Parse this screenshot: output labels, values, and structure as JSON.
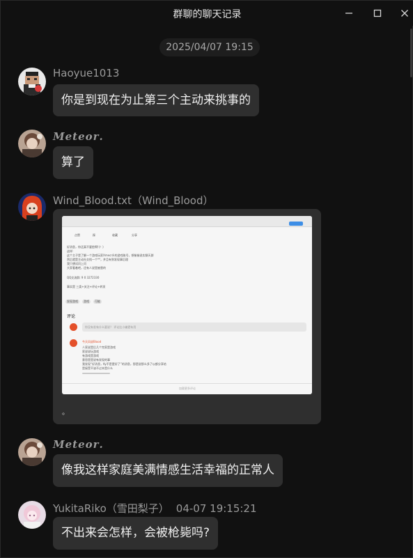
{
  "window": {
    "title": "群聊的聊天记录"
  },
  "timestamp": "2025/04/07 19:15",
  "messages": [
    {
      "sender": "Haoyue1013",
      "text": "你是到现在为止第三个主动来挑事的",
      "avatar_icon": "pixel-avatar-icon"
    },
    {
      "sender": "𝑴𝒆𝒕𝒆𝒐𝒓.",
      "text": "算了",
      "avatar_icon": "anime-avatar-icon"
    },
    {
      "sender": "Wind_Blood.txt（Wind_Blood）",
      "image_caption": "。",
      "avatar_icon": "red-hair-avatar-icon"
    },
    {
      "sender": "𝑴𝒆𝒕𝒆𝒐𝒓.",
      "text": "像我这样家庭美满情感生活幸福的正常人",
      "avatar_icon": "anime-avatar-icon"
    },
    {
      "sender": "YukitaRiko（雪田梨子）",
      "time": "04-07 19:15:21",
      "text": "不出来会怎样，会被枪毙吗?",
      "avatar_icon": "pink-hair-avatar-icon"
    }
  ],
  "screenshot": {
    "toolbar": [
      "点赞",
      "踩",
      "收藏",
      "分享"
    ],
    "body_lines": [
      "好消息，你还真不要脸啊!(！)",
      "这样:",
      "这个主子是了解一个游戏玩家Xmecr/k的游戏账号，想偷偷说实聊天群",
      "然后就是主动社交找一个**，并且有到发现事后理",
      "我只想试问上问",
      "大家看着吧，还有人说是被害的",
      "QQ交流群: 9 0 3272330",
      "事实是 三类+关注+评论+转发"
    ],
    "tags": [
      "发现游戏",
      "游戏",
      "可能"
    ],
    "comments_label": "评论",
    "comment_placeholder": "你没有发有什么要说？ 评论比小编更有用",
    "reply_name": "今天风说Blood",
    "reply_lines": [
      "人家说是后几个完家是游戏",
      "家说说玩游戏",
      "有游戏是游戏",
      "意思是是说有发现的事",
      "我发现“好消息，Ky不是更好了”的消息，那是说那么多了以都分享给",
      "是接受不该不过本是什么"
    ],
    "load_more": "加载更多评论"
  }
}
